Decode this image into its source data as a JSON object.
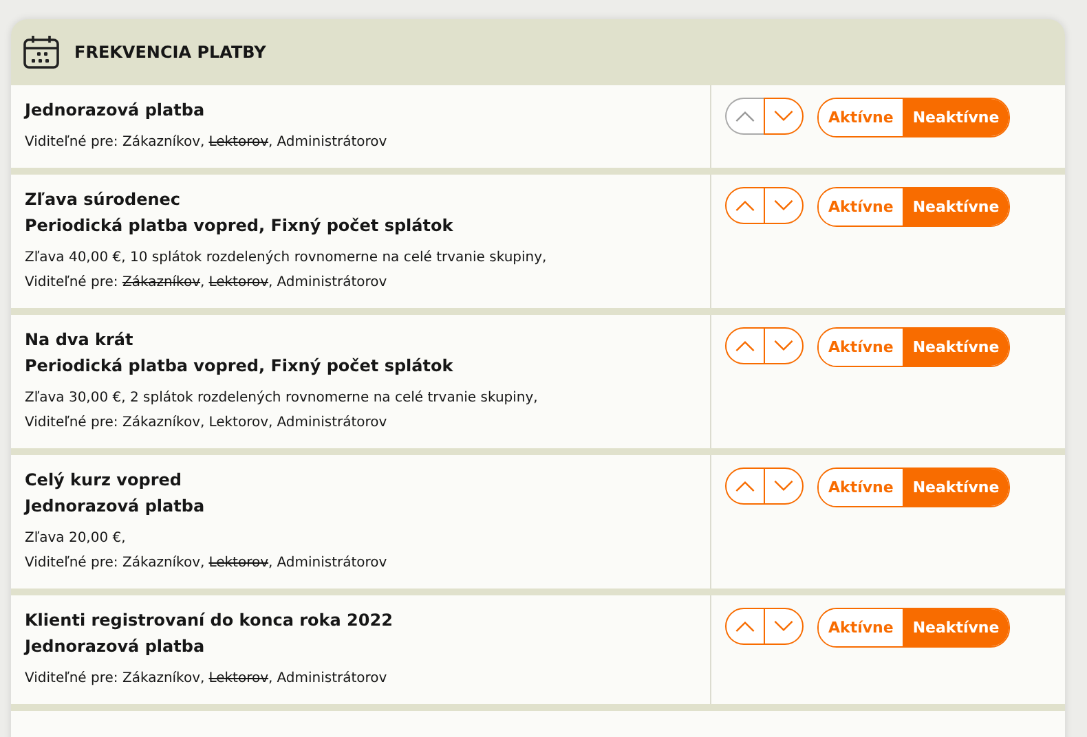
{
  "panel": {
    "title": "FREKVENCIA PLATBY"
  },
  "items": [
    {
      "title": "Jednorazová platba",
      "visibility_label": "Viditeľné pre:",
      "audiences": [
        {
          "label": "Zákazníkov",
          "struck": false,
          "separator": ","
        },
        {
          "label": "Lektorov",
          "struck": true,
          "separator": ","
        },
        {
          "label": "Administrátorov",
          "struck": false
        }
      ],
      "up_disabled": true,
      "down_disabled": false,
      "status": [
        {
          "label": "Aktívne",
          "selected": false
        },
        {
          "label": "Neaktívne",
          "selected": true
        }
      ]
    },
    {
      "title": "Zľava súrodenec",
      "subtitle": "Periodická platba vopred, Fixný počet splátok",
      "details": "Zľava 40,00 €, 10 splátok rozdelených rovnomerne na celé trvanie skupiny,",
      "visibility_label": "Viditeľné pre:",
      "audiences": [
        {
          "label": "Zákazníkov",
          "struck": true,
          "separator": ","
        },
        {
          "label": "Lektorov",
          "struck": true,
          "separator": ","
        },
        {
          "label": "Administrátorov",
          "struck": false
        }
      ],
      "up_disabled": false,
      "down_disabled": false,
      "status": [
        {
          "label": "Aktívne",
          "selected": false
        },
        {
          "label": "Neaktívne",
          "selected": true
        }
      ]
    },
    {
      "title": "Na dva krát",
      "subtitle": "Periodická platba vopred, Fixný počet splátok",
      "details": "Zľava 30,00 €, 2 splátok rozdelených rovnomerne na celé trvanie skupiny,",
      "visibility_label": "Viditeľné pre:",
      "audiences": [
        {
          "label": "Zákazníkov",
          "struck": false,
          "separator": ","
        },
        {
          "label": "Lektorov",
          "struck": false,
          "separator": ","
        },
        {
          "label": "Administrátorov",
          "struck": false
        }
      ],
      "up_disabled": false,
      "down_disabled": false,
      "status": [
        {
          "label": "Aktívne",
          "selected": false
        },
        {
          "label": "Neaktívne",
          "selected": true
        }
      ]
    },
    {
      "title": "Celý kurz vopred",
      "subtitle": "Jednorazová platba",
      "details": "Zľava 20,00 €,",
      "visibility_label": "Viditeľné pre:",
      "audiences": [
        {
          "label": "Zákazníkov",
          "struck": false,
          "separator": ","
        },
        {
          "label": "Lektorov",
          "struck": true,
          "separator": ","
        },
        {
          "label": "Administrátorov",
          "struck": false
        }
      ],
      "up_disabled": false,
      "down_disabled": false,
      "status": [
        {
          "label": "Aktívne",
          "selected": false
        },
        {
          "label": "Neaktívne",
          "selected": true
        }
      ]
    },
    {
      "title": "Klienti registrovaní do konca roka 2022",
      "subtitle": "Jednorazová platba",
      "visibility_label": "Viditeľné pre:",
      "audiences": [
        {
          "label": "Zákazníkov",
          "struck": false,
          "separator": ","
        },
        {
          "label": "Lektorov",
          "struck": true,
          "separator": ","
        },
        {
          "label": "Administrátorov",
          "struck": false
        }
      ],
      "up_disabled": false,
      "down_disabled": false,
      "status": [
        {
          "label": "Aktívne",
          "selected": false
        },
        {
          "label": "Neaktívne",
          "selected": true
        }
      ]
    }
  ]
}
